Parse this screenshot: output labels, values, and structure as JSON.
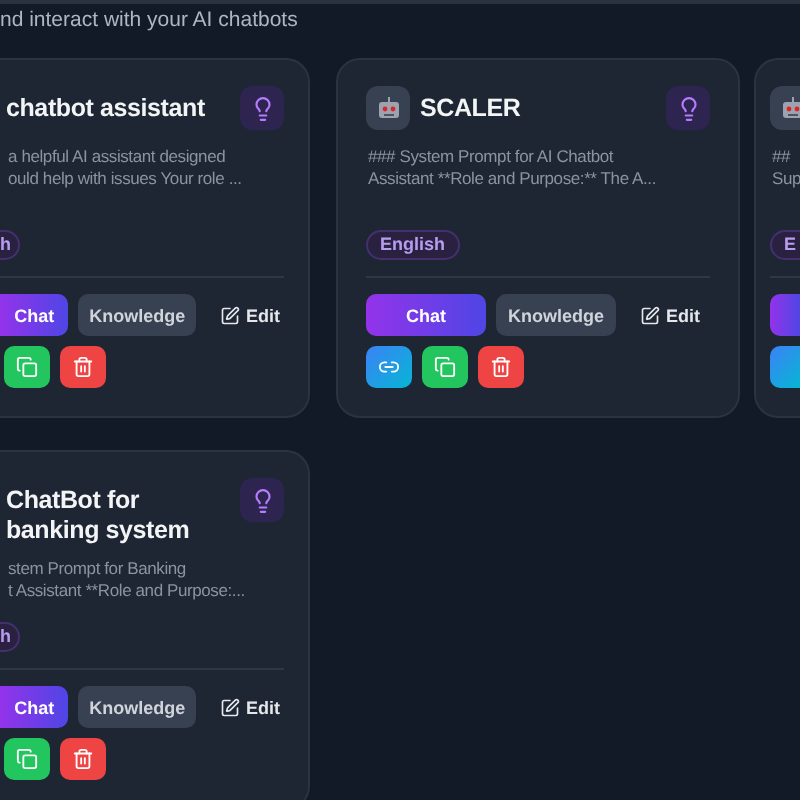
{
  "header": {
    "subtitle": "nd interact with your AI chatbots"
  },
  "cards": [
    {
      "kind": "cut-left",
      "title": "chatbot assistant",
      "description": [
        "a helpful AI assistant designed",
        "ould help with issues Your role ..."
      ],
      "tag": "h",
      "buttons": {
        "chat": "Chat",
        "knowledge": "Knowledge",
        "edit": "Edit"
      },
      "actions": [
        {
          "kind": "copy"
        },
        {
          "kind": "delete"
        }
      ]
    },
    {
      "kind": "full",
      "title": "SCALER",
      "description": [
        "### System Prompt for AI Chatbot",
        "Assistant **Role and Purpose:** The A..."
      ],
      "tag": "English",
      "buttons": {
        "chat": "Chat",
        "knowledge": "Knowledge",
        "edit": "Edit"
      },
      "actions": [
        {
          "kind": "link"
        },
        {
          "kind": "copy"
        },
        {
          "kind": "delete"
        }
      ]
    },
    {
      "kind": "cut-right",
      "description": [
        "##",
        "Sup"
      ],
      "tag": "E",
      "actions": [
        {
          "kind": "link"
        }
      ]
    },
    {
      "kind": "cut-left",
      "title": "ChatBot for banking system",
      "description": [
        "stem Prompt for Banking",
        "t Assistant **Role and Purpose:..."
      ],
      "tag": "h",
      "buttons": {
        "chat": "Chat",
        "knowledge": "Knowledge",
        "edit": "Edit"
      },
      "actions": [
        {
          "kind": "copy"
        },
        {
          "kind": "delete"
        }
      ]
    }
  ]
}
